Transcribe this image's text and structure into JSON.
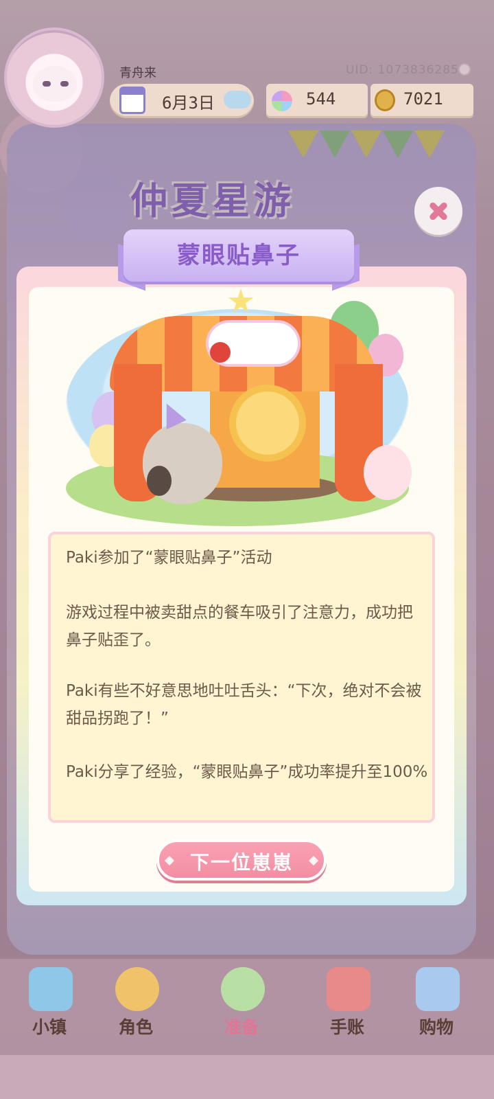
{
  "player": {
    "name": "青舟来",
    "uid": "UID: 1073836285"
  },
  "stats": {
    "date": "6月3日",
    "gems": "544",
    "coins": "7021"
  },
  "event_banner": "仲夏星游",
  "dialog": {
    "title": "蒙眼贴鼻子",
    "paragraphs": [
      "Paki参加了“蒙眼贴鼻子”活动",
      "游戏过程中被卖甜点的餐车吸引了注意力，成功把鼻子贴歪了。",
      "Paki有些不好意思地吐吐舌头：“下次，绝对不会被甜品拐跑了！”",
      "Paki分享了经验，“蒙眼贴鼻子”成功率提升至100%"
    ],
    "next_button": "下一位崽崽"
  },
  "nav": [
    {
      "label": "小镇",
      "icon": "map-icon"
    },
    {
      "label": "角色",
      "icon": "character-icon"
    },
    {
      "label": "准备",
      "icon": "bouquet-icon"
    },
    {
      "label": "手账",
      "icon": "journal-icon"
    },
    {
      "label": "购物",
      "icon": "shopping-bag-icon"
    }
  ],
  "colors": {
    "accent_pink": "#f28ea4",
    "title_purple": "#8a5cc9",
    "story_text": "#6b5a4a"
  }
}
